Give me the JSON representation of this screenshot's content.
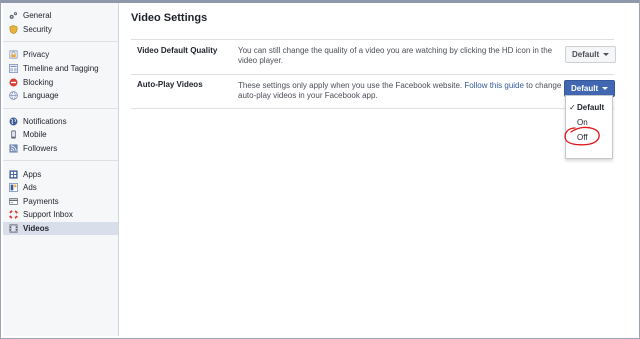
{
  "sidebar": {
    "groups": [
      {
        "items": [
          {
            "label": "General",
            "icon": "gear-icon"
          },
          {
            "label": "Security",
            "icon": "shield-icon"
          }
        ]
      },
      {
        "items": [
          {
            "label": "Privacy",
            "icon": "lock-icon"
          },
          {
            "label": "Timeline and Tagging",
            "icon": "timeline-icon"
          },
          {
            "label": "Blocking",
            "icon": "block-icon"
          },
          {
            "label": "Language",
            "icon": "globe-icon"
          }
        ]
      },
      {
        "items": [
          {
            "label": "Notifications",
            "icon": "globe-icon"
          },
          {
            "label": "Mobile",
            "icon": "mobile-icon"
          },
          {
            "label": "Followers",
            "icon": "rss-icon"
          }
        ]
      },
      {
        "items": [
          {
            "label": "Apps",
            "icon": "apps-icon"
          },
          {
            "label": "Ads",
            "icon": "ads-icon"
          },
          {
            "label": "Payments",
            "icon": "card-icon"
          },
          {
            "label": "Support Inbox",
            "icon": "lifebuoy-icon"
          },
          {
            "label": "Videos",
            "icon": "film-icon",
            "active": true
          }
        ]
      }
    ]
  },
  "main": {
    "title": "Video Settings",
    "rows": [
      {
        "label": "Video Default Quality",
        "description": "You can still change the quality of a video you are watching by clicking the HD icon in the video player.",
        "button": "Default"
      },
      {
        "label": "Auto-Play Videos",
        "description_before": "These settings only apply when you use the Facebook website. ",
        "link": "Follow this guide",
        "description_after": " to change auto-play videos in your Facebook app.",
        "button": "Default"
      }
    ],
    "menu": {
      "options": [
        "Default",
        "On",
        "Off"
      ],
      "selected": "Default",
      "check_glyph": "✓"
    }
  },
  "colors": {
    "accent": "#4267b2",
    "link": "#365899",
    "active_bg": "#d8dfea",
    "annotation": "#e0141b"
  }
}
